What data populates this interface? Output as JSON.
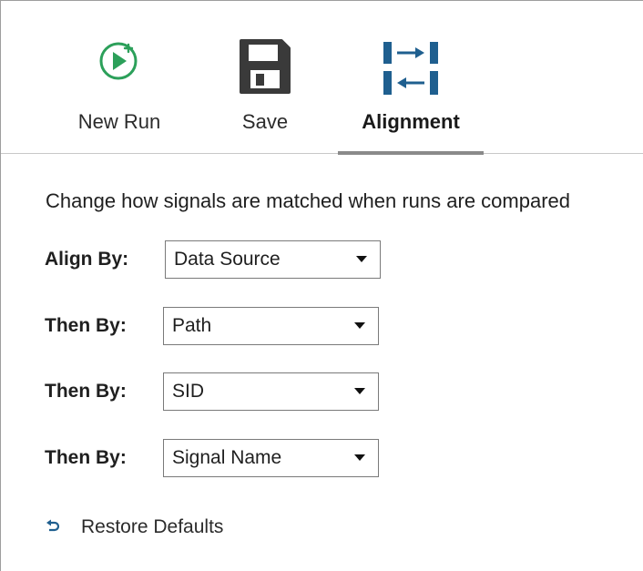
{
  "toolbar": {
    "new_run": {
      "label": "New Run",
      "icon": "play-add-icon",
      "color": "#2ca05a"
    },
    "save": {
      "label": "Save",
      "icon": "floppy-disk-icon",
      "color": "#3a3a3a"
    },
    "alignment": {
      "label": "Alignment",
      "icon": "alignment-icon",
      "color": "#1f5f8f",
      "active": true
    }
  },
  "panel": {
    "description": "Change how signals are matched when runs are compared",
    "rows": [
      {
        "label": "Align By:",
        "value": "Data Source"
      },
      {
        "label": "Then By:",
        "value": "Path"
      },
      {
        "label": "Then By:",
        "value": "SID"
      },
      {
        "label": "Then By:",
        "value": "Signal Name"
      }
    ],
    "restore": {
      "label": "Restore Defaults",
      "icon": "undo-arrow-icon",
      "color": "#1f5f8f"
    }
  }
}
